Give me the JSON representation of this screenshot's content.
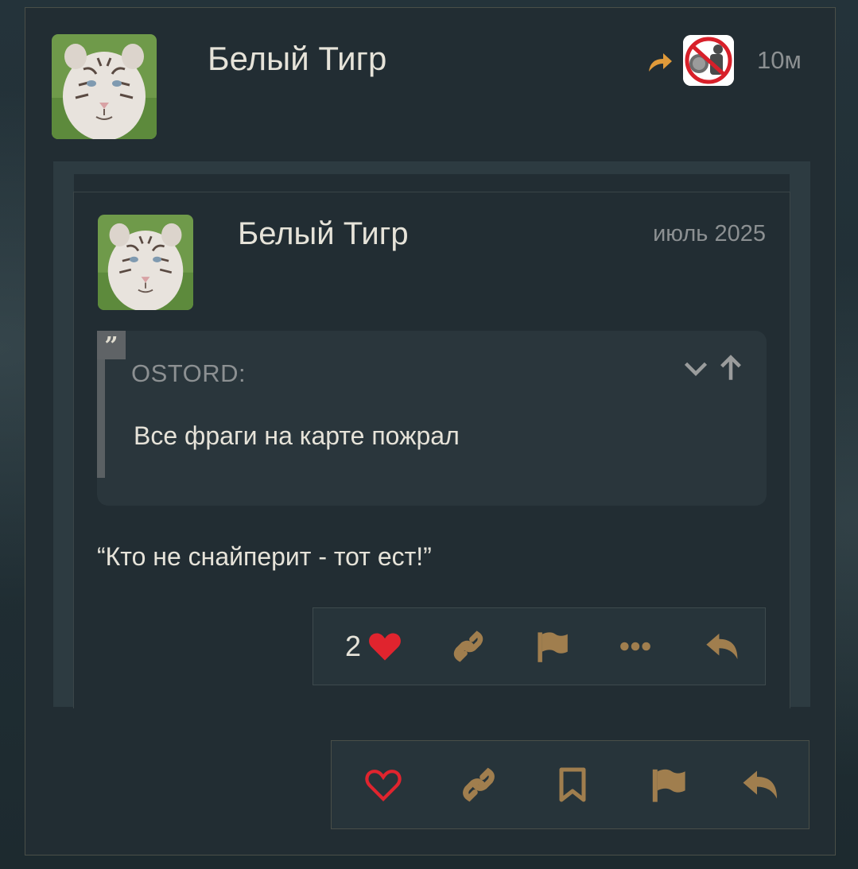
{
  "post": {
    "author": "Белый Тигр",
    "time": "10м"
  },
  "embedded_post": {
    "author": "Белый Тигр",
    "date": "июль 2025",
    "quote": {
      "user": "OSTORD:",
      "text": "Все фраги на карте пожрал"
    },
    "body": "“Кто не снайперит - тот ест!”",
    "like_count": "2"
  },
  "colors": {
    "accent_gold": "#a07e4e",
    "heart_red": "#e0242e",
    "text_light": "#e6e3d9",
    "text_muted": "#8c9092"
  },
  "icons": {
    "embedded_actions": [
      "heart-filled-icon",
      "link-icon",
      "flag-icon",
      "more-icon",
      "reply-icon"
    ],
    "post_actions": [
      "heart-outline-icon",
      "link-icon",
      "bookmark-icon",
      "flag-icon",
      "reply-icon"
    ]
  }
}
